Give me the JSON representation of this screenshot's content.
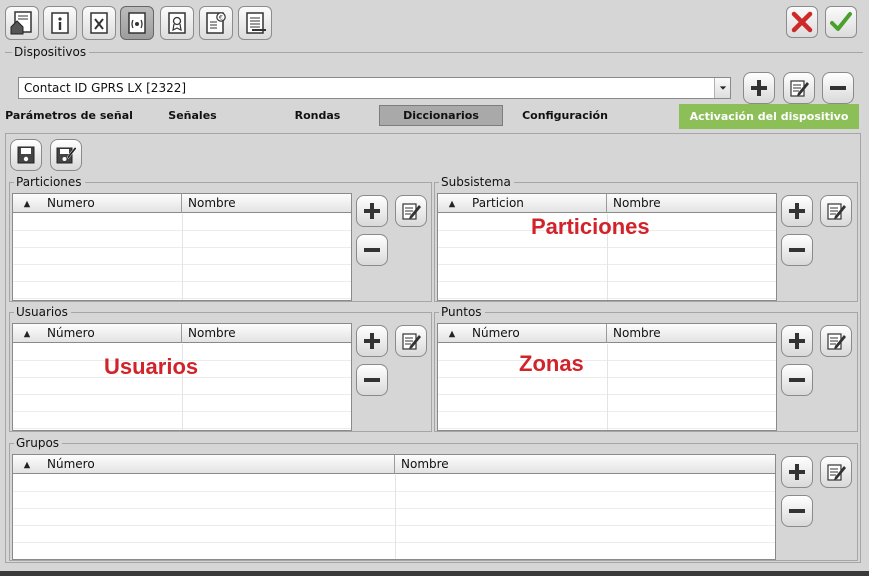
{
  "colors": {
    "accent_green": "#8cbf58",
    "overlay_red": "#d2232a",
    "selected_tab": "#a9a9a9"
  },
  "toolbar": {
    "icons": [
      "home-document-icon",
      "info-document-icon",
      "x-document-icon",
      "signal-document-icon",
      "badge-document-icon",
      "euro-document-icon",
      "list-document-icon"
    ],
    "cancel_icon": "red-x-icon",
    "accept_icon": "green-check-icon"
  },
  "devices": {
    "section_title": "Dispositivos",
    "selected": "Contact ID GPRS LX [2322]"
  },
  "tabs": [
    {
      "label": "Parámetros de señal"
    },
    {
      "label": "Señales"
    },
    {
      "label": "Rondas"
    },
    {
      "label": "Diccionarios"
    },
    {
      "label": "Configuración"
    },
    {
      "label": "Activación del dispositivo"
    }
  ],
  "panels": {
    "particiones": {
      "title": "Particiones",
      "columns": [
        "Numero",
        "Nombre"
      ]
    },
    "subsistema": {
      "title": "Subsistema",
      "columns": [
        "Particion",
        "Nombre"
      ],
      "overlay": "Particiones"
    },
    "usuarios": {
      "title": "Usuarios",
      "columns": [
        "Número",
        "Nombre"
      ],
      "overlay": "Usuarios"
    },
    "puntos": {
      "title": "Puntos",
      "columns": [
        "Número",
        "Nombre"
      ],
      "overlay": "Zonas"
    },
    "grupos": {
      "title": "Grupos",
      "columns": [
        "Número",
        "Nombre"
      ]
    }
  }
}
